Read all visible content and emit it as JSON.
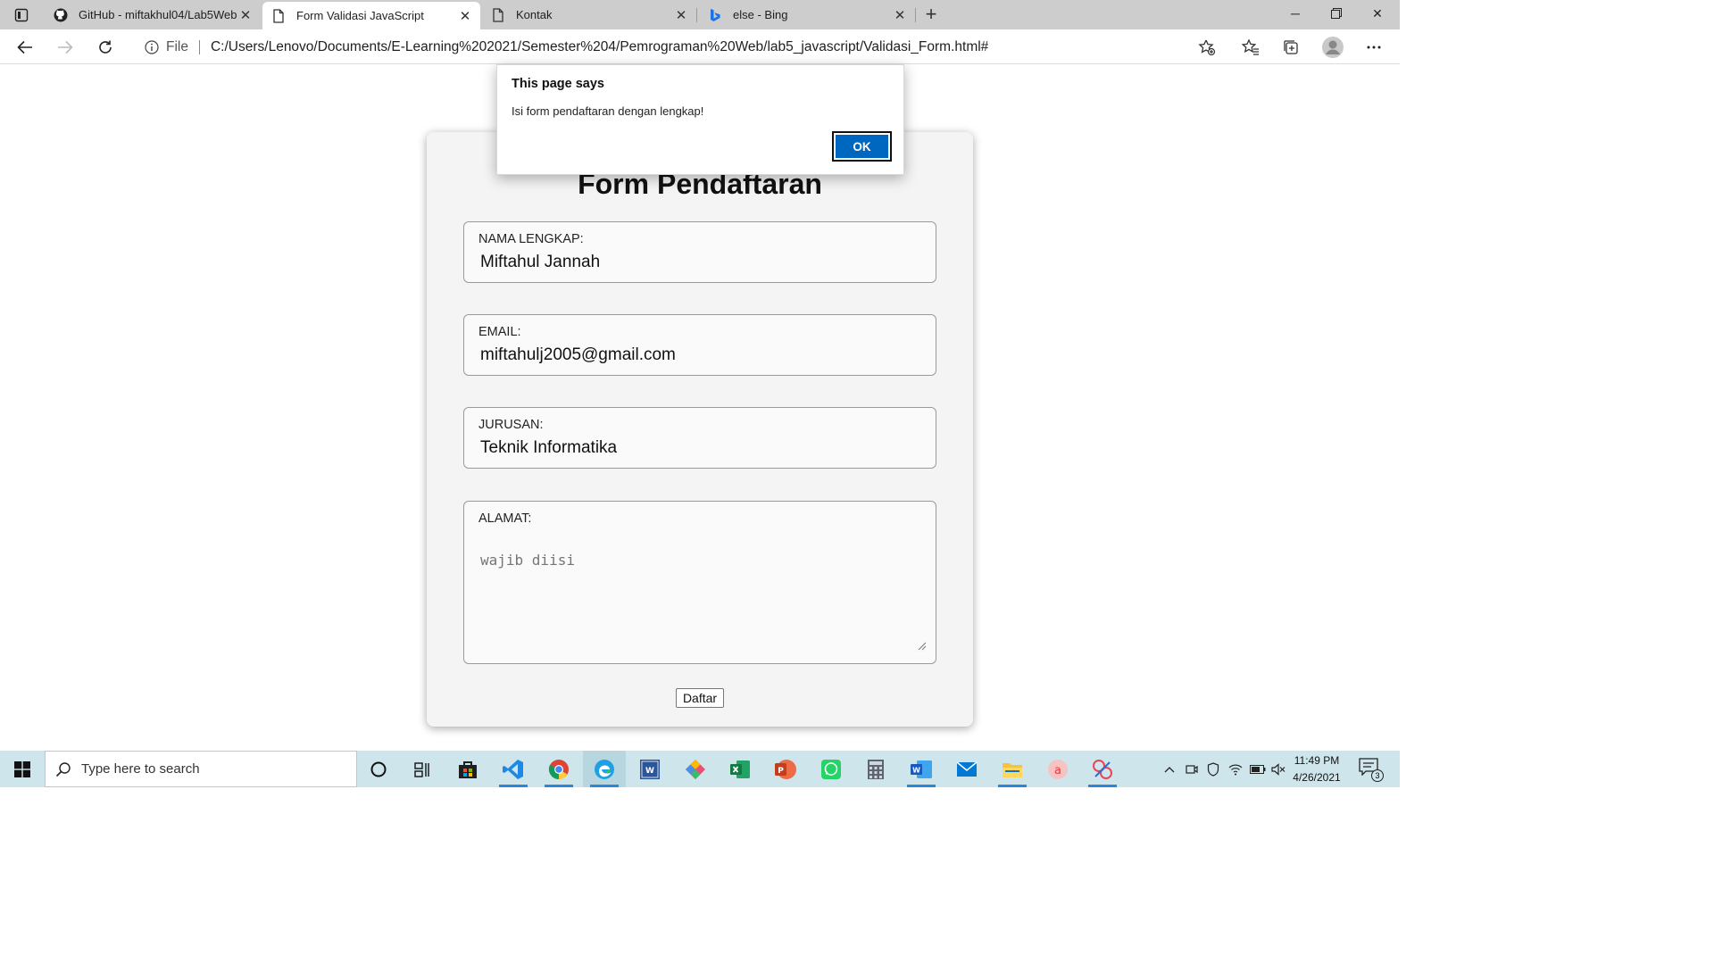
{
  "browser": {
    "tabs": [
      {
        "title": "GitHub - miftakhul04/Lab5Web",
        "icon": "github-icon",
        "active": false
      },
      {
        "title": "Form Validasi JavaScript",
        "icon": "page-icon",
        "active": true
      },
      {
        "title": "Kontak",
        "icon": "page-icon",
        "active": false
      },
      {
        "title": "else - Bing",
        "icon": "bing-icon",
        "active": false
      }
    ],
    "scheme_label": "File",
    "url": "C:/Users/Lenovo/Documents/E-Learning%202021/Semester%204/Pemrograman%20Web/lab5_javascript/Validasi_Form.html#"
  },
  "form": {
    "title": "Form Pendaftaran",
    "fields": [
      {
        "label": "NAMA LENGKAP:",
        "value": "Miftahul Jannah"
      },
      {
        "label": "EMAIL:",
        "value": "miftahulj2005@gmail.com"
      },
      {
        "label": "JURUSAN:",
        "value": "Teknik Informatika"
      },
      {
        "label": "ALAMAT:",
        "placeholder": "wajib diisi"
      }
    ],
    "submit_label": "Daftar"
  },
  "dialog": {
    "title": "This page says",
    "message": "Isi form pendaftaran dengan lengkap!",
    "ok_label": "OK",
    "accent": "#0067c0"
  },
  "taskbar": {
    "search_placeholder": "Type here to search",
    "apps": [
      "cortana-icon",
      "task-view-icon",
      "store-icon",
      "vscode-icon",
      "chrome-icon",
      "edge-icon",
      "word-alt-icon",
      "gitkraken-icon",
      "excel-icon",
      "powerpoint-icon",
      "whatsapp-icon",
      "calculator-icon",
      "word-icon",
      "mail-icon",
      "file-explorer-icon",
      "app-a-icon",
      "snipping-icon"
    ],
    "time": "11:49 PM",
    "date": "4/26/2021",
    "notification_count": "3"
  }
}
